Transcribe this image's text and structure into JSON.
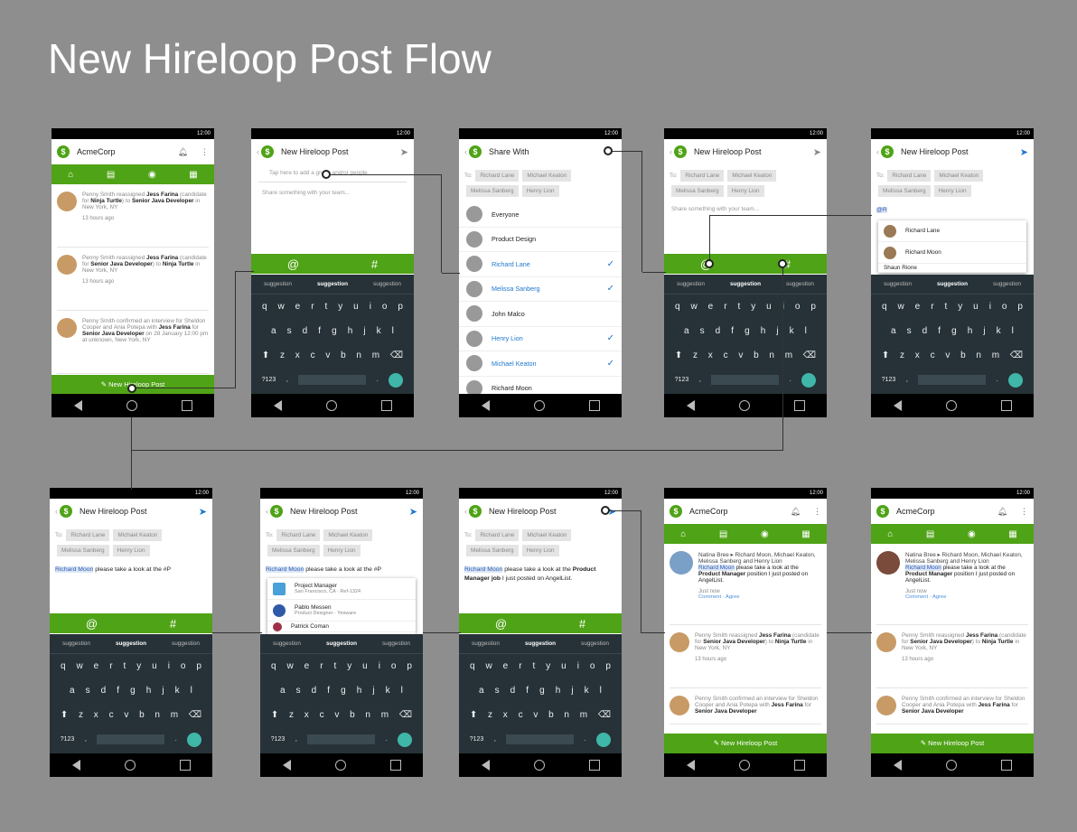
{
  "title": "New Hireloop Post Flow",
  "status_time": "12:00",
  "company": "AcmeCorp",
  "new_post_title": "New Hireloop Post",
  "share_with_title": "Share With",
  "at_key": "@",
  "hash_key": "#",
  "new_post_button": "New Hireloop Post",
  "to_label": "To:",
  "chips": [
    "Richard Lane",
    "Michael Keaton",
    "Melissa Sanberg",
    "Henry Lion"
  ],
  "placeholder_group": "Tap here to add a group and/or people",
  "placeholder_share": "Share something with your team...",
  "suggestions": [
    "suggestion",
    "suggestion",
    "suggestion"
  ],
  "keys_row1": [
    "q",
    "w",
    "e",
    "r",
    "t",
    "y",
    "u",
    "i",
    "o",
    "p"
  ],
  "keys_row2": [
    "a",
    "s",
    "d",
    "f",
    "g",
    "h",
    "j",
    "k",
    "l"
  ],
  "keys_row3": [
    "⬆",
    "z",
    "x",
    "c",
    "v",
    "b",
    "n",
    "m",
    "⌫"
  ],
  "keys_num": "?123",
  "feed": [
    {
      "pre": "Penny Smith reassigned ",
      "name": "Jess Farina",
      "mid": " (candidate for ",
      "role": "Ninja Turtle",
      "mid2": ") to ",
      "job": "Senior Java Developer",
      "post": " in New York, NY",
      "time": "13 hours ago"
    },
    {
      "pre": "Penny Smith reassigned ",
      "name": "Jess Farina",
      "mid": " (candidate for ",
      "role": "Senior Java Developer",
      "mid2": ") to ",
      "job": "Ninja Turtle",
      "post": " in New York, NY",
      "time": "13 hours ago"
    },
    {
      "pre": "Penny Smith confirmed an interview for Sheldon Cooper and Ania Potepa with ",
      "name": "Jess Farina",
      "mid": " for ",
      "role": "Senior Java Developer",
      "mid2": " on 28 January 12:00 pm at unknown, New York, NY",
      "job": "",
      "post": "",
      "time": ""
    }
  ],
  "share_list": [
    {
      "name": "Everyone",
      "checked": false,
      "blue": false
    },
    {
      "name": "Product Design",
      "checked": false,
      "blue": false
    },
    {
      "name": "Richard Lane",
      "checked": true,
      "blue": true
    },
    {
      "name": "Melissa Sanberg",
      "checked": true,
      "blue": true
    },
    {
      "name": "John Malco",
      "checked": false,
      "blue": false
    },
    {
      "name": "Henry Lion",
      "checked": true,
      "blue": true
    },
    {
      "name": "Michael Keaton",
      "checked": true,
      "blue": true
    },
    {
      "name": "Richard Moon",
      "checked": false,
      "blue": false
    }
  ],
  "mention_typed": "@R",
  "mention_list": [
    "Richard Lane",
    "Richard Moon",
    "Shaun Rione"
  ],
  "msg_mention": "Richard Moon",
  "msg_text1": " please take a look at the #P",
  "msg_text2": " please take a look at the ",
  "msg_bold": "Product Manager job",
  "msg_tail": " I just posted on AngelList.",
  "hash_popup": [
    {
      "title": "Project Manager",
      "sub": "San Francisco, CA  ·  Ref-1324"
    },
    {
      "title": "Pablo Messen",
      "sub": "Product Designer  ·  Yesware"
    },
    {
      "title": "Patrick Coman",
      "sub": ""
    }
  ],
  "final_post": {
    "names": "Natina Bree ▸ Richard Moon, Michael Keaton, Melissa Sanberg and Henry Lion",
    "mention": "Richard Moon",
    "text1": " please take a look at the ",
    "bold": "Product Manager",
    "text2": " position I just posted on AngelList.",
    "time": "Just now",
    "comment": "Comment",
    "agree": "Agree"
  }
}
